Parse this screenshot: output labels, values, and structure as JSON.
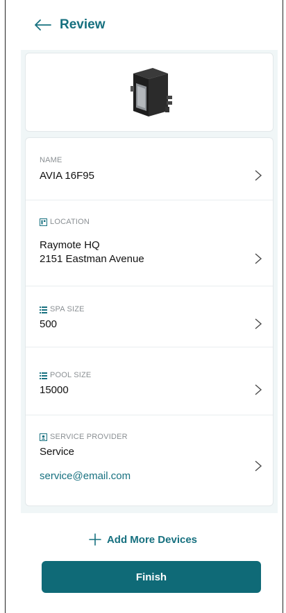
{
  "header": {
    "title": "Review"
  },
  "device_image": {
    "icon": "heater-unit-image"
  },
  "fields": {
    "name": {
      "label": "NAME",
      "value": "AVIA 16F95"
    },
    "location": {
      "label": "LOCATION",
      "line1": "Raymote HQ",
      "line2": "2151 Eastman Avenue"
    },
    "spa_size": {
      "label": "SPA SIZE",
      "value": "500"
    },
    "pool_size": {
      "label": "POOL SIZE",
      "value": "15000"
    },
    "service_provider": {
      "label": "SERVICE PROVIDER",
      "name": "Service",
      "email": "service@email.com"
    }
  },
  "actions": {
    "add_more_label": "Add More Devices",
    "finish_label": "Finish"
  },
  "colors": {
    "accent": "#16707f",
    "button": "#0f6a77",
    "panel_bg": "#f0f6f7"
  }
}
